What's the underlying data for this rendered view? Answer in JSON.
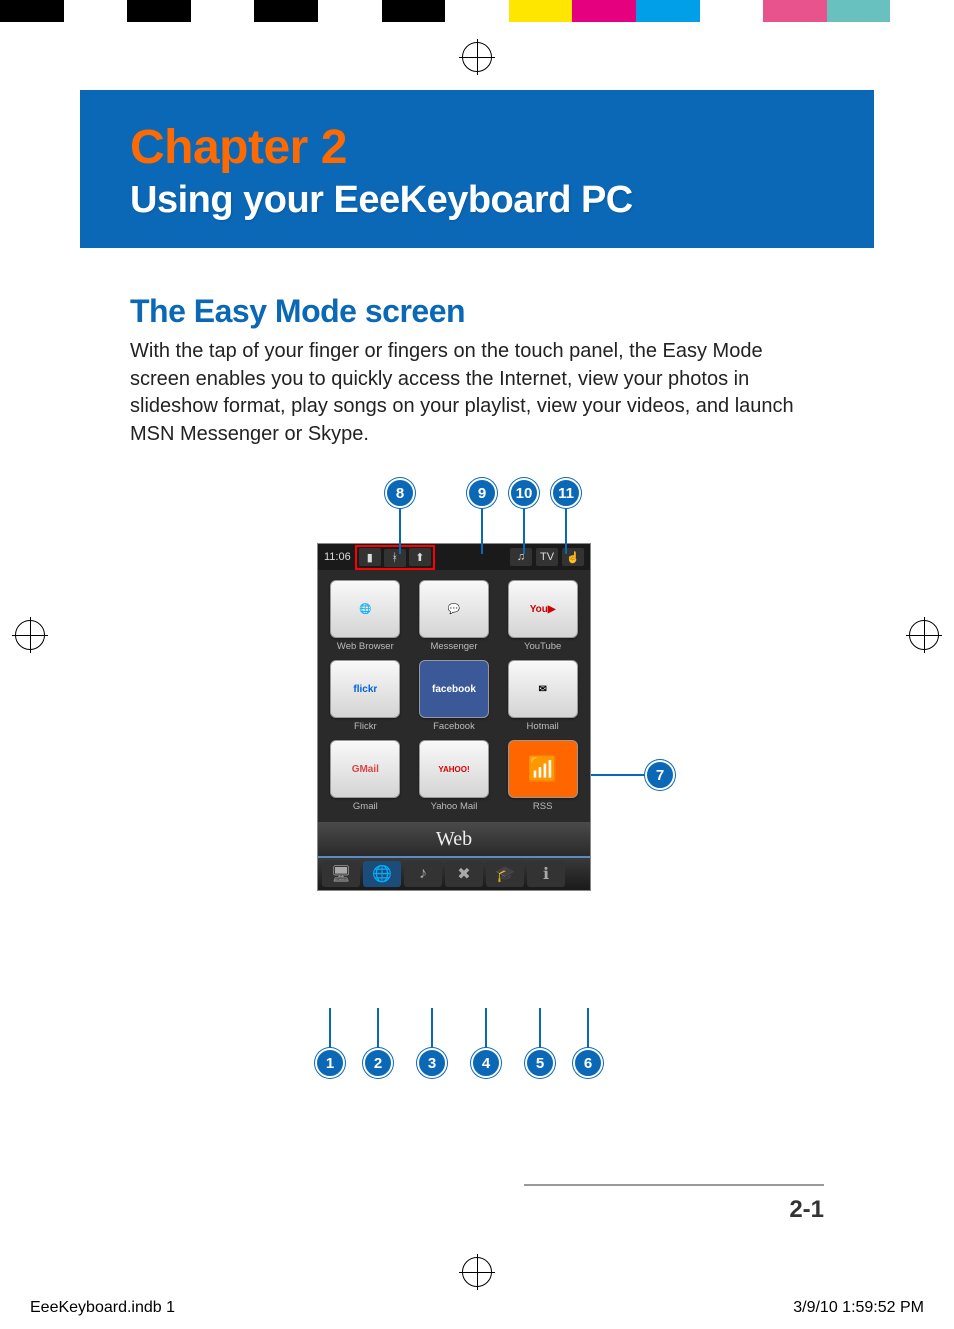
{
  "colorbar": [
    "#000000",
    "#ffffff",
    "#000000",
    "#ffffff",
    "#000000",
    "#ffffff",
    "#000000",
    "#ffffff",
    "#ffe600",
    "#e4007f",
    "#009fe8",
    "#ffffff",
    "#e8528d",
    "#69c1bf",
    "#ffffff"
  ],
  "chapter": {
    "number": "Chapter 2",
    "title": "Using your EeeKeyboard PC"
  },
  "section": {
    "heading": "The Easy Mode screen",
    "body": "With the tap of your finger or fingers on the touch panel, the Easy Mode screen enables you to quickly access the Internet, view your photos in slideshow format, play songs on your playlist, view your videos, and launch MSN Messenger or Skype."
  },
  "screenshot": {
    "time": "11:06",
    "status_icons": [
      "battery-icon",
      "bluetooth-icon",
      "signal-icon"
    ],
    "top_buttons": [
      "music-icon",
      "tv-icon",
      "touch-icon"
    ],
    "apps": [
      {
        "label": "Web Browser",
        "icon": "globe-icon",
        "ic_text": "🌐"
      },
      {
        "label": "Messenger",
        "icon": "messenger-icon",
        "ic_text": "💬"
      },
      {
        "label": "YouTube",
        "icon": "youtube-icon",
        "ic_text": "You▶"
      },
      {
        "label": "Flickr",
        "icon": "flickr-icon",
        "ic_text": "flickr"
      },
      {
        "label": "Facebook",
        "icon": "facebook-icon",
        "ic_text": "facebook"
      },
      {
        "label": "Hotmail",
        "icon": "hotmail-icon",
        "ic_text": "✉"
      },
      {
        "label": "Gmail",
        "icon": "gmail-icon",
        "ic_text": "GMail"
      },
      {
        "label": "Yahoo Mail",
        "icon": "yahoo-mail-icon",
        "ic_text": "YAHOO!"
      },
      {
        "label": "RSS",
        "icon": "rss-icon",
        "ic_text": "📶"
      }
    ],
    "tab_label": "Web",
    "bottom_icons": [
      "desktop-icon",
      "web-icon",
      "music-note-icon",
      "tools-icon",
      "graduation-icon",
      "info-icon"
    ]
  },
  "callouts": {
    "top": [
      "8",
      "9",
      "10",
      "11"
    ],
    "right": "7",
    "bottom": [
      "1",
      "2",
      "3",
      "4",
      "5",
      "6"
    ]
  },
  "page_number": "2-1",
  "slug": {
    "file": "EeeKeyboard.indb   1",
    "stamp": "3/9/10   1:59:52 PM"
  }
}
